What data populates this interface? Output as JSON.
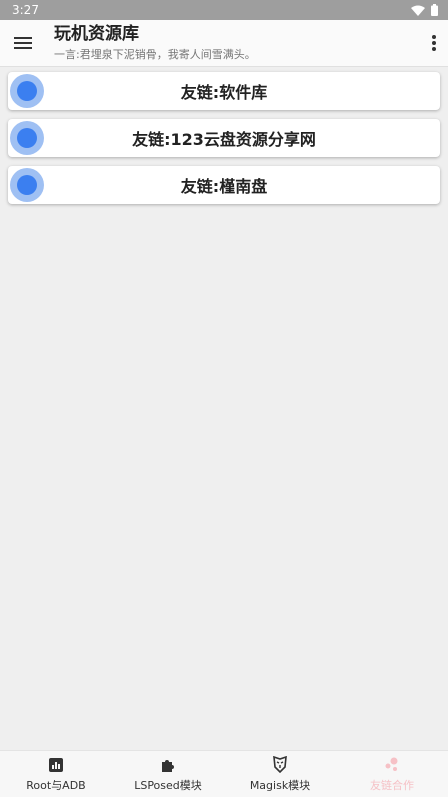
{
  "status_bar": {
    "time": "3:27"
  },
  "app_bar": {
    "title": "玩机资源库",
    "subtitle": "一言:君埋泉下泥销骨，我寄人间雪满头。"
  },
  "cards": [
    {
      "label": "友链:软件库"
    },
    {
      "label": "友链:123云盘资源分享网"
    },
    {
      "label": "友链:槿南盘"
    }
  ],
  "bottom_nav": {
    "items": [
      {
        "label": "Root与ADB",
        "icon": "chart-icon",
        "active": false
      },
      {
        "label": "LSPosed模块",
        "icon": "puzzle-icon",
        "active": false
      },
      {
        "label": "Magisk模块",
        "icon": "mask-icon",
        "active": false
      },
      {
        "label": "友链合作",
        "icon": "bubbles-icon",
        "active": true
      }
    ]
  },
  "colors": {
    "accent": "#3b7ff0",
    "accent_light": "#9fc0f3",
    "active_nav": "#f6c1c6",
    "status_bar": "#9e9e9e",
    "background": "#efefef"
  }
}
